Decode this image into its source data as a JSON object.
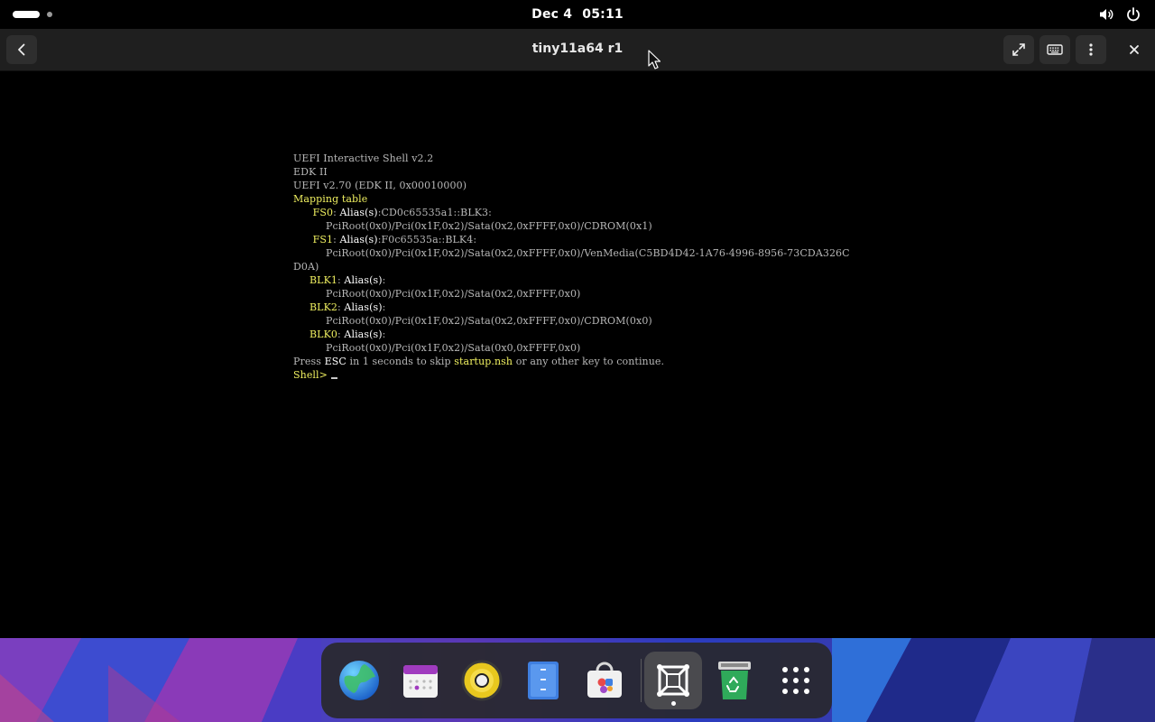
{
  "topbar": {
    "date": "Dec 4",
    "time": "05:11",
    "icons": [
      "volume-icon",
      "power-icon"
    ]
  },
  "window": {
    "title": "tiny11a64 r1",
    "buttons": [
      "back-icon",
      "fullscreen-icon",
      "keyboard-icon",
      "menu-icon",
      "close-icon"
    ]
  },
  "terminal": {
    "lines": [
      [
        {
          "t": "UEFI Interactive Shell v2.2",
          "c": "gy"
        }
      ],
      [
        {
          "t": "EDK II",
          "c": "gy"
        }
      ],
      [
        {
          "t": "UEFI v2.70 (EDK II, 0x00010000)",
          "c": "gy"
        }
      ],
      [
        {
          "t": "Mapping table",
          "c": "yl"
        }
      ],
      [
        {
          "t": "      ",
          "c": "gy"
        },
        {
          "t": "FS0",
          "c": "yl"
        },
        {
          "t": ": ",
          "c": "gy"
        },
        {
          "t": "Alias(s)",
          "c": "wt"
        },
        {
          "t": ":CD0c65535a1::BLK3:",
          "c": "gy"
        }
      ],
      [
        {
          "t": "          PciRoot(0x0)/Pci(0x1F,0x2)/Sata(0x2,0xFFFF,0x0)/CDROM(0x1)",
          "c": "gy"
        }
      ],
      [
        {
          "t": "      ",
          "c": "gy"
        },
        {
          "t": "FS1",
          "c": "yl"
        },
        {
          "t": ": ",
          "c": "gy"
        },
        {
          "t": "Alias(s)",
          "c": "wt"
        },
        {
          "t": ":F0c65535a::BLK4:",
          "c": "gy"
        }
      ],
      [
        {
          "t": "          PciRoot(0x0)/Pci(0x1F,0x2)/Sata(0x2,0xFFFF,0x0)/VenMedia(C5BD4D42-1A76-4996-8956-73CDA326C",
          "c": "gy"
        }
      ],
      [
        {
          "t": "D0A)",
          "c": "gy"
        }
      ],
      [
        {
          "t": "     ",
          "c": "gy"
        },
        {
          "t": "BLK1",
          "c": "yl"
        },
        {
          "t": ": ",
          "c": "gy"
        },
        {
          "t": "Alias(s)",
          "c": "wt"
        },
        {
          "t": ":",
          "c": "gy"
        }
      ],
      [
        {
          "t": "          PciRoot(0x0)/Pci(0x1F,0x2)/Sata(0x2,0xFFFF,0x0)",
          "c": "gy"
        }
      ],
      [
        {
          "t": "     ",
          "c": "gy"
        },
        {
          "t": "BLK2",
          "c": "yl"
        },
        {
          "t": ": ",
          "c": "gy"
        },
        {
          "t": "Alias(s)",
          "c": "wt"
        },
        {
          "t": ":",
          "c": "gy"
        }
      ],
      [
        {
          "t": "          PciRoot(0x0)/Pci(0x1F,0x2)/Sata(0x2,0xFFFF,0x0)/CDROM(0x0)",
          "c": "gy"
        }
      ],
      [
        {
          "t": "     ",
          "c": "gy"
        },
        {
          "t": "BLK0",
          "c": "yl"
        },
        {
          "t": ": ",
          "c": "gy"
        },
        {
          "t": "Alias(s)",
          "c": "wt"
        },
        {
          "t": ":",
          "c": "gy"
        }
      ],
      [
        {
          "t": "          PciRoot(0x0)/Pci(0x1F,0x2)/Sata(0x0,0xFFFF,0x0)",
          "c": "gy"
        }
      ],
      [
        {
          "t": "Press ",
          "c": "gy"
        },
        {
          "t": "ESC",
          "c": "wt"
        },
        {
          "t": " in 1 seconds to skip ",
          "c": "gy"
        },
        {
          "t": "startup.nsh",
          "c": "yl"
        },
        {
          "t": " or any other key to continue.",
          "c": "gy"
        }
      ],
      [
        {
          "t": "Shell> ",
          "c": "yl"
        }
      ]
    ]
  },
  "dock": {
    "apps": [
      {
        "name": "browser-app-icon",
        "active": false
      },
      {
        "name": "calendar-app-icon",
        "active": false
      },
      {
        "name": "music-app-icon",
        "active": false
      },
      {
        "name": "files-app-icon",
        "active": false
      },
      {
        "name": "software-app-icon",
        "active": false
      },
      {
        "name": "boxes-app-icon",
        "active": true
      },
      {
        "name": "trash-app-icon",
        "active": false
      },
      {
        "name": "app-grid-icon",
        "active": false
      }
    ]
  }
}
